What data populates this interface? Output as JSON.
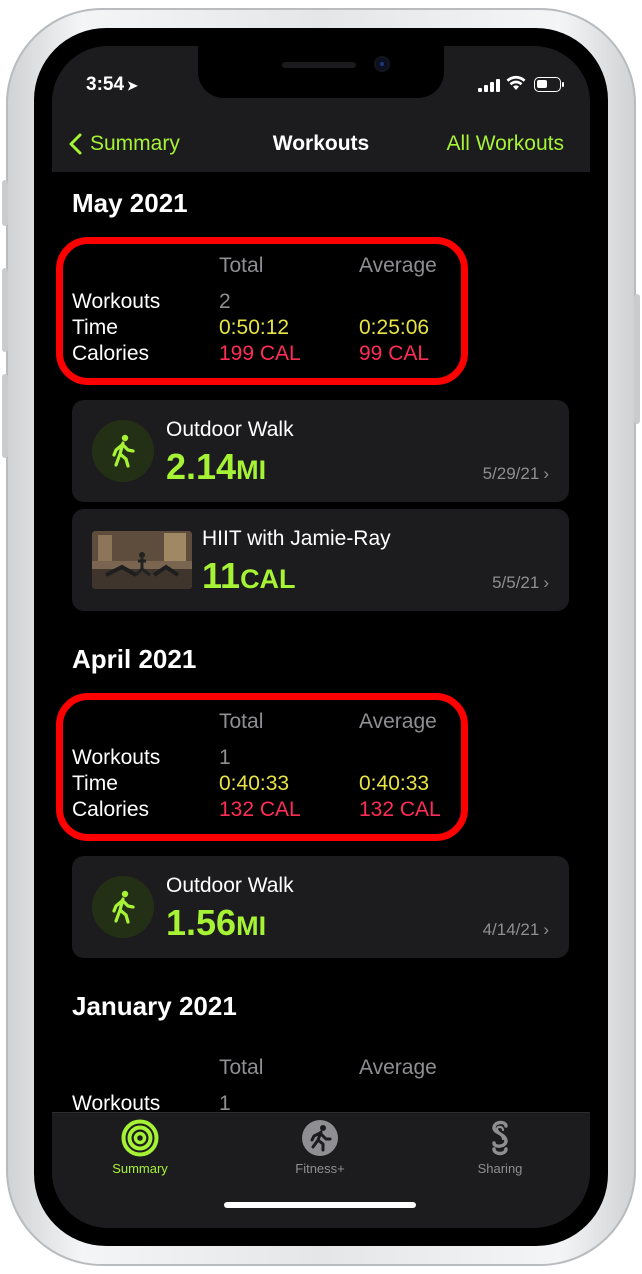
{
  "status_bar": {
    "time": "3:54",
    "location_icon": "location-arrow-icon"
  },
  "nav": {
    "back_label": "Summary",
    "title": "Workouts",
    "right_label": "All Workouts"
  },
  "sections": [
    {
      "month": "May 2021",
      "headers": {
        "total": "Total",
        "average": "Average"
      },
      "rows": [
        {
          "label": "Workouts",
          "total": "2",
          "average": ""
        },
        {
          "label": "Time",
          "total": "0:50:12",
          "average": "0:25:06"
        },
        {
          "label": "Calories",
          "total": "199 CAL",
          "average": "99 CAL"
        }
      ],
      "workouts": [
        {
          "title": "Outdoor Walk",
          "value": "2.14",
          "unit": "MI",
          "date": "5/29/21",
          "icon": "walking-figure-icon"
        },
        {
          "title": "HIIT with Jamie-Ray",
          "value": "11",
          "unit": "CAL",
          "date": "5/5/21",
          "icon": "video-thumbnail"
        }
      ]
    },
    {
      "month": "April 2021",
      "headers": {
        "total": "Total",
        "average": "Average"
      },
      "rows": [
        {
          "label": "Workouts",
          "total": "1",
          "average": ""
        },
        {
          "label": "Time",
          "total": "0:40:33",
          "average": "0:40:33"
        },
        {
          "label": "Calories",
          "total": "132 CAL",
          "average": "132 CAL"
        }
      ],
      "workouts": [
        {
          "title": "Outdoor Walk",
          "value": "1.56",
          "unit": "MI",
          "date": "4/14/21",
          "icon": "walking-figure-icon"
        }
      ]
    },
    {
      "month": "January 2021",
      "headers": {
        "total": "Total",
        "average": "Average"
      },
      "rows": [
        {
          "label": "Workouts",
          "total": "1",
          "average": ""
        }
      ]
    }
  ],
  "tabs": [
    {
      "label": "Summary",
      "active": true,
      "icon": "activity-rings-icon"
    },
    {
      "label": "Fitness+",
      "active": false,
      "icon": "fitness-plus-icon"
    },
    {
      "label": "Sharing",
      "active": false,
      "icon": "sharing-icon"
    }
  ],
  "colors": {
    "accent": "#a6f235",
    "time": "#e7e343",
    "calories": "#ff2d55",
    "highlight": "#ff0000"
  }
}
